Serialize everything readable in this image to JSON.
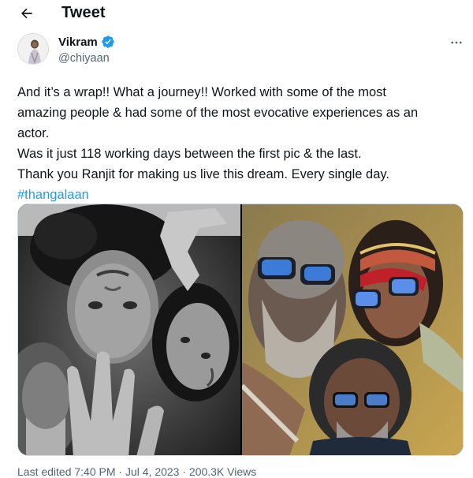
{
  "header": {
    "title": "Tweet",
    "back_icon": "arrow-left-icon"
  },
  "author": {
    "display_name": "Vikram",
    "handle": "@chiyaan",
    "verified_icon": "verified-badge-icon",
    "verified_color": "#1d9bf0",
    "more_icon": "more-horizontal-icon"
  },
  "tweet": {
    "lines": [
      "And it’s a wrap!! What a journey!!  Worked with some of the most",
      "amazing people & had some of the most evocative experiences as an",
      "actor.",
      "Was it just 118 working days between the first pic & the last.",
      "Thank you Ranjit for making us live this dream. Every single day."
    ],
    "hashtag": "#thangalaan",
    "link_color": "#1d9bf0"
  },
  "media": {
    "photos": [
      {
        "name": "black-and-white-selfie-photo"
      },
      {
        "name": "color-costume-selfie-photo"
      }
    ]
  },
  "meta": {
    "text": "Last edited 7:40 PM · Jul 4, 2023 · 200.3K Views"
  }
}
